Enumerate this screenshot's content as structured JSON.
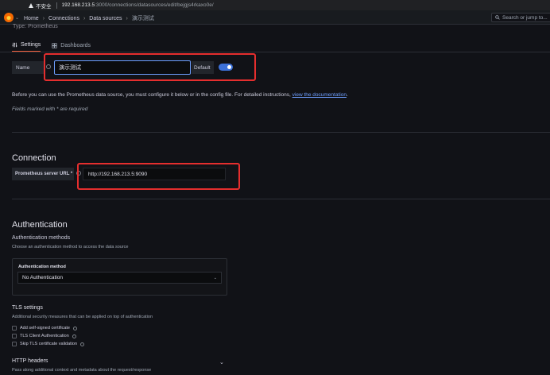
{
  "browser": {
    "security_label": "不安全",
    "url_host": "192.168.213.5",
    "url_path": ":3000/connections/datasources/edit/bejgjs4rkaxo0e/"
  },
  "nav": {
    "breadcrumbs": [
      "Home",
      "Connections",
      "Data sources",
      "演示测试"
    ],
    "search_placeholder": "Search or jump to..."
  },
  "page": {
    "type_label": "Type: Prometheus",
    "tabs": [
      {
        "label": "Settings",
        "active": true
      },
      {
        "label": "Dashboards",
        "active": false
      }
    ]
  },
  "form": {
    "name_label": "Name",
    "name_value": "演示测试",
    "default_label": "Default",
    "default_on": true,
    "intro_text": "Before you can use the Prometheus data source, you must configure it below or in the config file. For detailed instructions, ",
    "intro_link": "view the documentation",
    "intro_tail": ".",
    "fields_required": "Fields marked with * are required"
  },
  "connection": {
    "heading": "Connection",
    "url_label": "Prometheus server URL *",
    "url_value": "http://192.168.213.5:9090"
  },
  "authentication": {
    "heading": "Authentication",
    "methods_title": "Authentication methods",
    "methods_desc": "Choose an authentication method to access the data source",
    "method_label": "Authentication method",
    "method_value": "No Authentication"
  },
  "tls": {
    "title": "TLS settings",
    "desc": "Additional security measures that can be applied on top of authentication",
    "options": [
      "Add self-signed certificate",
      "TLS Client Authentication",
      "Skip TLS certificate validation"
    ]
  },
  "http": {
    "title": "HTTP headers",
    "desc": "Pass along additional context and metadata about the request/response"
  },
  "colors": {
    "highlight": "#e52e2e",
    "accent": "#3d71d9",
    "tab_active": "#f55f3e"
  }
}
